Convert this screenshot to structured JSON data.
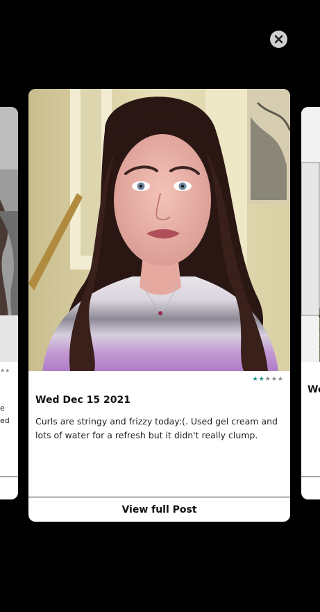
{
  "close_button": {
    "icon": "close-icon"
  },
  "left_card": {
    "rating": {
      "filled": 0,
      "total": 5
    },
    "text_fragments": [
      "e",
      "ed"
    ]
  },
  "main_card": {
    "rating": {
      "filled": 2,
      "total": 5,
      "filled_color": "#1a8f8a",
      "empty_color": "#8a8a8a"
    },
    "date": "Wed Dec 15 2021",
    "body": "Curls are stringy and frizzy today:(. Used gel cream and lots of water for a refresh but it didn't really clump.",
    "view_button_label": "View full Post"
  },
  "right_card": {
    "title_fragment": "We"
  }
}
